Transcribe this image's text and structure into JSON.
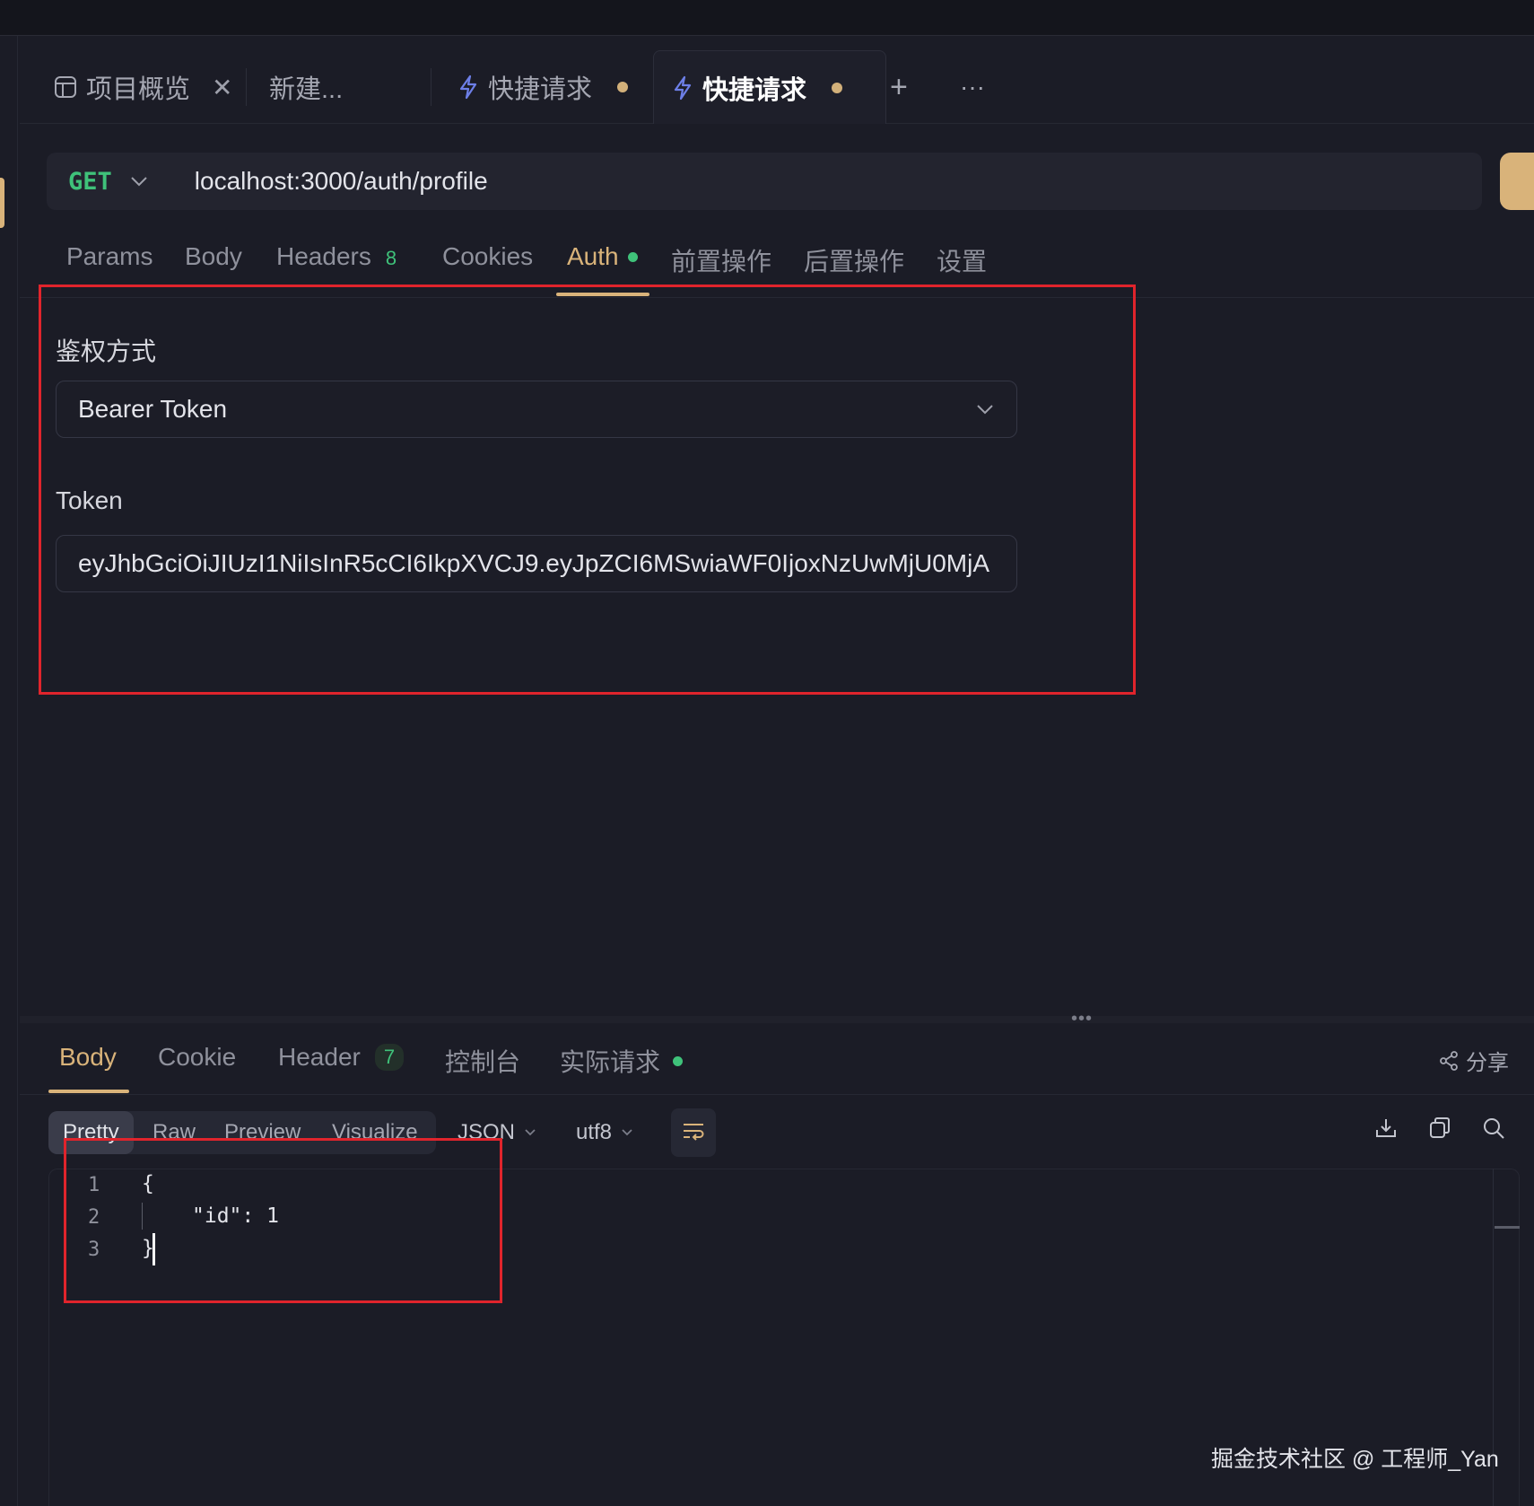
{
  "tabs": [
    {
      "label": "项目概览",
      "icon": "layout-icon",
      "close": "✕"
    },
    {
      "label": "新建..."
    },
    {
      "label": "快捷请求",
      "icon": "lightning-icon"
    },
    {
      "label": "快捷请求",
      "icon": "lightning-icon",
      "active": true
    }
  ],
  "tab_actions": {
    "add": "+",
    "more": "···"
  },
  "request": {
    "method": "GET",
    "url": "localhost:3000/auth/profile"
  },
  "request_tabs": {
    "params": "Params",
    "body": "Body",
    "headers": "Headers",
    "headers_count": "8",
    "cookies": "Cookies",
    "auth": "Auth",
    "pre_ops": "前置操作",
    "post_ops": "后置操作",
    "settings": "设置"
  },
  "auth": {
    "method_label": "鉴权方式",
    "method_value": "Bearer Token",
    "token_label": "Token",
    "token_value": "eyJhbGciOiJIUzI1NiIsInR5cCI6IkpXVCJ9.eyJpZCI6MSwiaWF0IjoxNzUwMjU0MjA"
  },
  "response_tabs": {
    "body": "Body",
    "cookie": "Cookie",
    "header": "Header",
    "header_count": "7",
    "console": "控制台",
    "actual_request": "实际请求",
    "share": "分享"
  },
  "view_modes": {
    "pretty": "Pretty",
    "raw": "Raw",
    "preview": "Preview",
    "visualize": "Visualize"
  },
  "format": "JSON",
  "encoding": "utf8",
  "code_lines": [
    {
      "n": "1",
      "text": "{"
    },
    {
      "n": "2",
      "text": "\"id\": 1"
    },
    {
      "n": "3",
      "text": "}"
    }
  ],
  "watermark": "掘金技术社区 @ 工程师_Yan",
  "colors": {
    "accent": "#d9b37a",
    "method_get": "#3fc27a",
    "annotation": "#e0242c",
    "background": "#1b1c26"
  }
}
